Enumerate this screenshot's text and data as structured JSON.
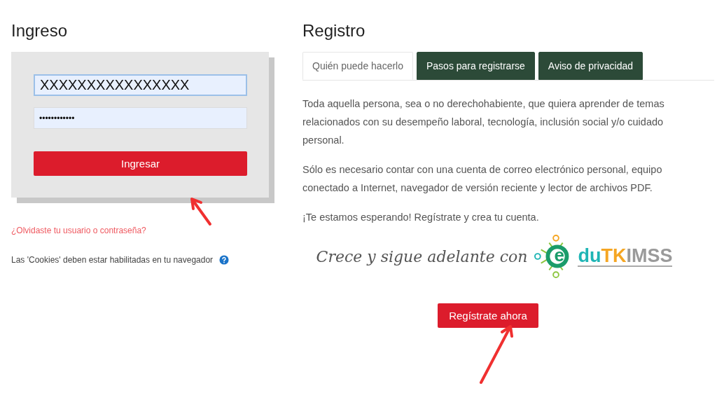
{
  "login": {
    "title": "Ingreso",
    "username": {
      "value": "XXXXXXXXXXXXXXXX",
      "focused": true
    },
    "password": {
      "value": "••••••••••••"
    },
    "submit": "Ingresar",
    "forgot_link": "¿Olvidaste tu usuario o contraseña?",
    "cookies_note": "Las 'Cookies' deben estar habilitadas en tu navegador"
  },
  "register": {
    "title": "Registro",
    "tabs": [
      {
        "label": "Quién puede hacerlo",
        "selected": true
      },
      {
        "label": "Pasos para registrarse",
        "selected": false
      },
      {
        "label": "Aviso de privacidad",
        "selected": false
      }
    ],
    "paragraphs": [
      "Toda aquella persona, sea o no derechohabiente, que quiera aprender de  temas relacionados con su desempeño laboral, tecnología, inclusión social y/o cuidado personal.",
      "Sólo es necesario contar con una cuenta de correo electrónico personal, equipo conectado a Internet, navegador de versión reciente y lector de archivos PDF.",
      "¡Te estamos esperando! Regístrate y crea tu cuenta."
    ],
    "banner": {
      "tagline": "Crece y sigue adelante con",
      "logo_letter": "e",
      "logo_parts": [
        {
          "text": "du",
          "color": "#1fb5b5"
        },
        {
          "text": "TK",
          "color": "#f5a623"
        },
        {
          "text": "IMSS",
          "color": "#9a9a9a"
        }
      ]
    },
    "submit": "Regístrate ahora"
  }
}
